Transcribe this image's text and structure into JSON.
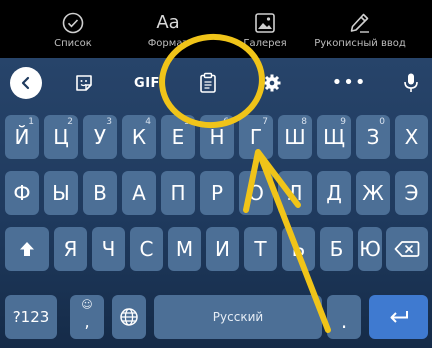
{
  "top_bar": {
    "items": [
      {
        "id": "list",
        "label": "Список",
        "icon": "check-circle-icon"
      },
      {
        "id": "format",
        "label": "Формат",
        "icon_text": "Aa"
      },
      {
        "id": "gallery",
        "label": "Галерея",
        "icon": "image-icon"
      },
      {
        "id": "handwriting",
        "label": "Рукописный ввод",
        "icon": "pen-icon"
      }
    ]
  },
  "keyboard": {
    "toolbar": {
      "back_icon": "chevron-left-icon",
      "sticker_icon": "sticker-icon",
      "gif_label": "GIF",
      "clipboard_icon": "clipboard-icon",
      "settings_icon": "gear-icon",
      "more_label": "•••",
      "mic_icon": "microphone-icon"
    },
    "row1": [
      {
        "ch": "Й",
        "hint": "1"
      },
      {
        "ch": "Ц",
        "hint": "2"
      },
      {
        "ch": "У",
        "hint": "3"
      },
      {
        "ch": "К",
        "hint": "4"
      },
      {
        "ch": "Е",
        "hint": "5"
      },
      {
        "ch": "Н",
        "hint": "6"
      },
      {
        "ch": "Г",
        "hint": "7"
      },
      {
        "ch": "Ш",
        "hint": "8"
      },
      {
        "ch": "Щ",
        "hint": "9"
      },
      {
        "ch": "З",
        "hint": "0"
      },
      {
        "ch": "Х",
        "hint": ""
      }
    ],
    "row2": [
      "Ф",
      "Ы",
      "В",
      "А",
      "П",
      "Р",
      "О",
      "Л",
      "Д",
      "Ж",
      "Э"
    ],
    "row3": [
      "Я",
      "Ч",
      "С",
      "М",
      "И",
      "Т",
      "Ь",
      "Б",
      "Ю"
    ],
    "bottom": {
      "symbols_label": "?123",
      "emoji_hint": "☺",
      "comma_label": ",",
      "globe_icon": "globe-icon",
      "space_label": "Русский",
      "period_label": ".",
      "shift_icon": "shift-arrow-icon",
      "backspace_icon": "backspace-icon",
      "enter_icon": "enter-icon"
    },
    "colors": {
      "key": "#4c6f96",
      "enter": "#3f7ad0",
      "annotation": "#f0c419"
    }
  }
}
